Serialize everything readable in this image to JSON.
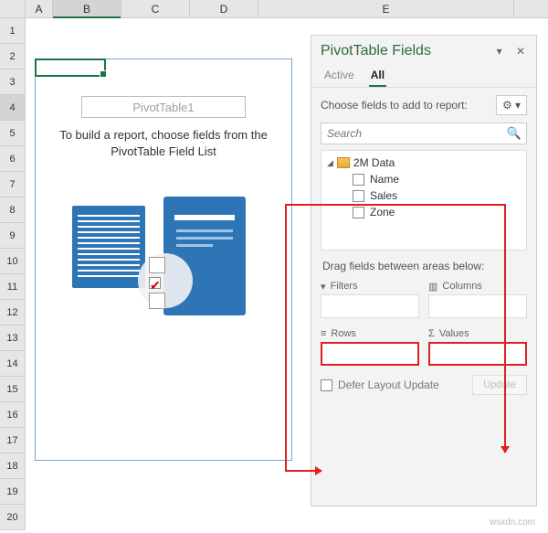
{
  "columns": [
    "A",
    "B",
    "C",
    "D",
    "E"
  ],
  "rows": [
    "1",
    "2",
    "3",
    "4",
    "5",
    "6",
    "7",
    "8",
    "9",
    "10",
    "11",
    "12",
    "13",
    "14",
    "15",
    "16",
    "17",
    "18",
    "19",
    "20"
  ],
  "active_cell": "B4",
  "pivot_placeholder": {
    "title": "PivotTable1",
    "message_line1": "To build a report, choose fields from the",
    "message_line2": "PivotTable Field List"
  },
  "pane": {
    "title": "PivotTable Fields",
    "tab_active": "Active",
    "tab_all": "All",
    "sub_label": "Choose fields to add to report:",
    "gear_label": "⚙ ▾",
    "search_placeholder": "Search",
    "data_source": "2M Data",
    "fields": [
      {
        "name": "Name"
      },
      {
        "name": "Sales"
      },
      {
        "name": "Zone"
      }
    ],
    "areas_label": "Drag fields between areas below:",
    "areas": {
      "filters": "Filters",
      "columns": "Columns",
      "rows": "Rows",
      "values": "Values"
    },
    "defer_label": "Defer Layout Update",
    "update_label": "Update"
  },
  "watermark": "wsxdn.com"
}
